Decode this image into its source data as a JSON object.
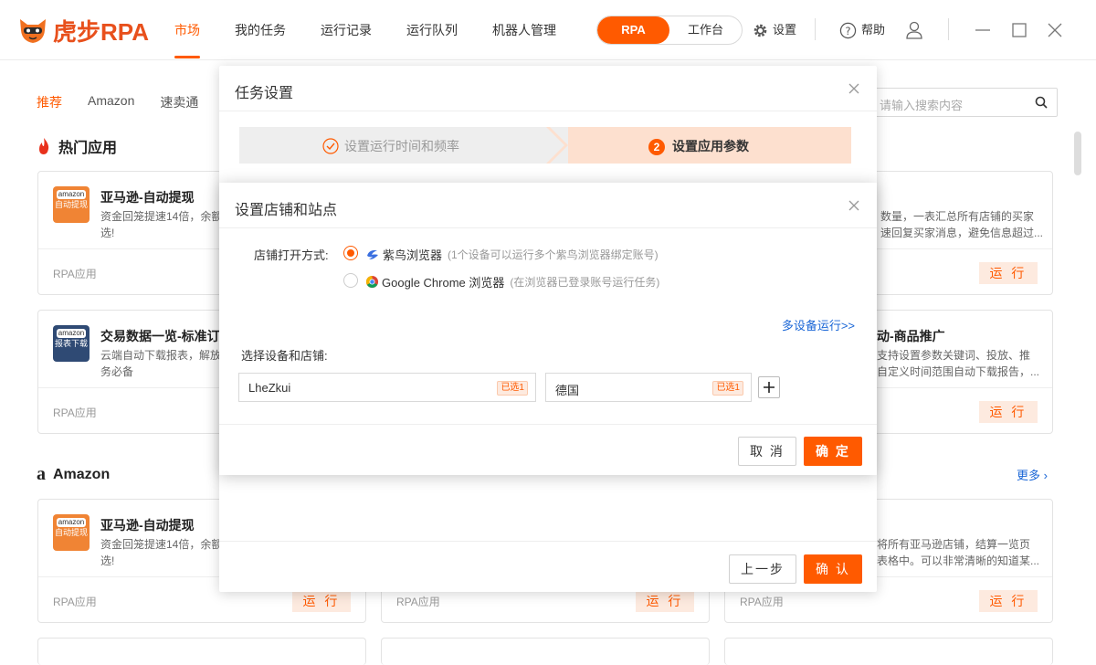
{
  "app": {
    "logo_text": "虎步RPA",
    "nav": [
      "市场",
      "我的任务",
      "运行记录",
      "运行队列",
      "机器人管理"
    ],
    "mode_switch": [
      "RPA",
      "工作台"
    ],
    "settings_label": "设置",
    "help_label": "帮助"
  },
  "market": {
    "subtabs": [
      "推荐",
      "Amazon",
      "速卖通"
    ],
    "search_placeholder": "请输入搜索内容",
    "hot_title": "热门应用",
    "amazon_title": "Amazon",
    "more_label": "更多",
    "cards_hot": [
      {
        "title": "亚马逊-自动提现",
        "desc": "资金回笼提速14倍，余额",
        "desc2": "选!",
        "tag": "RPA应用",
        "run": "运 行",
        "icon_brand": "amazon",
        "icon_text": "自动提现"
      },
      {
        "title": "",
        "desc": "数量，一表汇总所有店铺的买家",
        "desc2": "速回复买家消息，避免信息超过...",
        "tag": "",
        "run": "运 行"
      },
      {
        "title": "交易数据一览-标准订",
        "desc": "云端自动下载报表，解放",
        "desc2": "务必备",
        "tag": "RPA应用",
        "run": "",
        "icon_brand": "amazon",
        "icon_text": "报表下载"
      },
      {
        "title": "动-商品推广",
        "desc": "支持设置参数关键词、投放、推",
        "desc2": "自定义时间范围自动下载报告，...",
        "tag": "",
        "run": "运 行"
      }
    ],
    "cards_amazon": [
      {
        "title": "亚马逊-自动提现",
        "desc": "资金回笼提速14倍，余额",
        "desc2": "选!",
        "tag": "RPA应用",
        "run": "运 行",
        "icon_brand": "amazon",
        "icon_text": "自动提现"
      },
      {
        "title": "",
        "desc": "",
        "desc2": "",
        "tag": "RPA应用",
        "run": "运 行"
      },
      {
        "title": "",
        "desc": "将所有亚马逊店铺，结算一览页",
        "desc2": "表格中。可以非常清晰的知道某...",
        "tag": "RPA应用",
        "run": "运 行"
      }
    ]
  },
  "task_dialog": {
    "title": "任务设置",
    "step1": "设置运行时间和频率",
    "step2_num": "2",
    "step2": "设置应用参数",
    "prev_btn": "上一步",
    "confirm_btn": "确 认"
  },
  "store_dialog": {
    "title": "设置店铺和站点",
    "open_method_label": "店铺打开方式:",
    "options": [
      {
        "label": "紫鸟浏览器",
        "note": "(1个设备可以运行多个紫鸟浏览器绑定账号)",
        "checked": true
      },
      {
        "label": "Google Chrome 浏览器",
        "note": "(在浏览器已登录账号运行任务)",
        "checked": false
      }
    ],
    "multi_device_link": "多设备运行>>",
    "select_label": "选择设备和店铺:",
    "device_value": "LheZkui",
    "device_tag": "已选1",
    "site_value": "德国",
    "site_tag": "已选1",
    "cancel_btn": "取 消",
    "ok_btn": "确 定"
  },
  "colors": {
    "accent": "#ff5a00",
    "link": "#1a66d6",
    "step_active_bg": "#fde0cf"
  }
}
